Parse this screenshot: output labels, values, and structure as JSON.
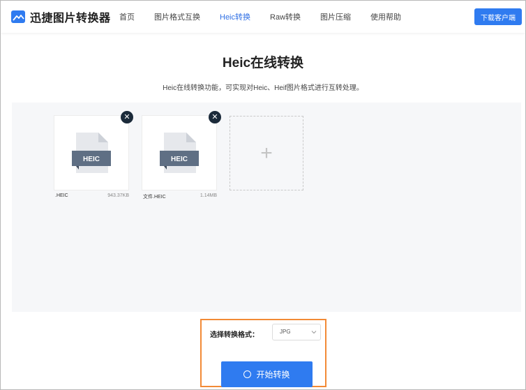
{
  "header": {
    "logo_text": "迅捷图片转换器",
    "nav": [
      {
        "label": "首页"
      },
      {
        "label": "图片格式互换"
      },
      {
        "label": "Heic转换"
      },
      {
        "label": "Raw转换"
      },
      {
        "label": "图片压缩"
      },
      {
        "label": "使用帮助"
      }
    ],
    "active_nav_index": 2,
    "download_label": "下载客户端"
  },
  "main": {
    "title": "Heic在线转换",
    "description": "Heic在线转换功能，可实现对Heic、Heif图片格式进行互转处理。"
  },
  "files": [
    {
      "name": ".HEIC",
      "size": "943.37KB",
      "badge": "HEIC",
      "remove_glyph": "✕"
    },
    {
      "name": "文件.HEIC",
      "size": "1.14MB",
      "badge": "HEIC",
      "remove_glyph": "✕"
    }
  ],
  "add_glyph": "+",
  "convert": {
    "format_label": "选择转换格式：",
    "format_value": "JPG",
    "start_label": "开始转换"
  },
  "colors": {
    "accent": "#2f7bf0",
    "nav_active": "#2f6fe4",
    "highlight_border": "#f28a36",
    "badge_bg": "#5f6f84",
    "remove_bg": "#1b2a3a"
  },
  "icons": {
    "logo": "landscape-logo-icon",
    "file": "heic-file-icon",
    "remove": "close-icon",
    "add": "plus-icon",
    "select": "chevron-down-icon",
    "loading": "circle-icon"
  }
}
